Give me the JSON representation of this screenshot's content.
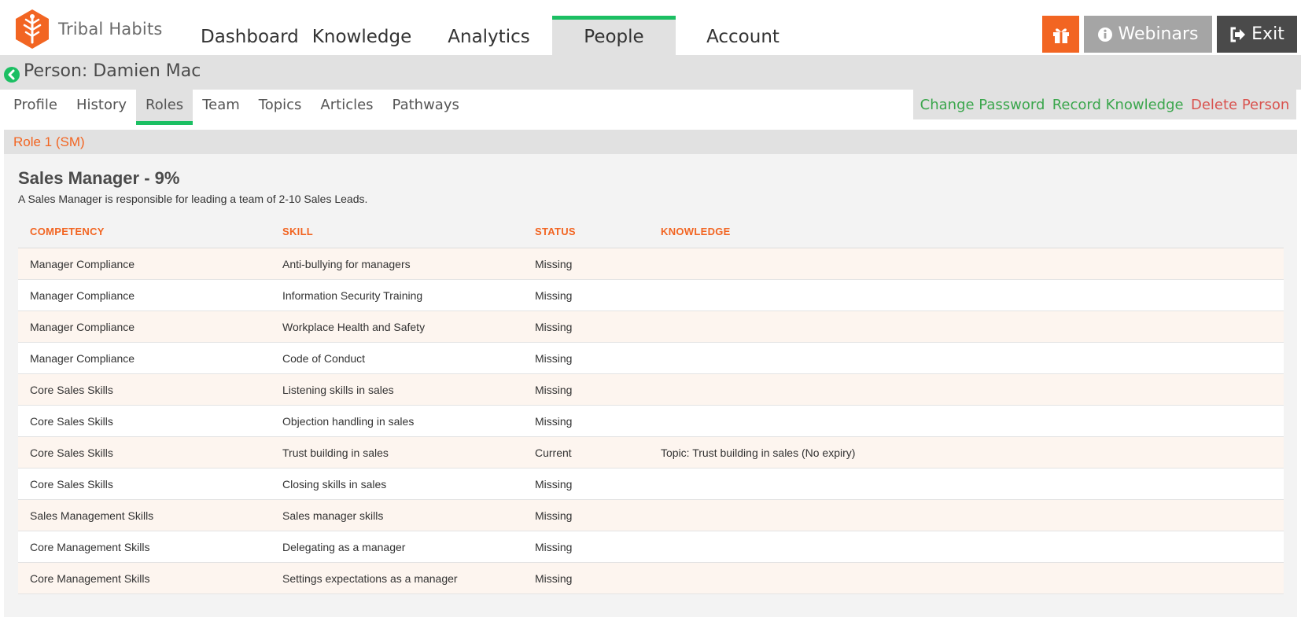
{
  "brand": {
    "name": "Tribal Habits"
  },
  "main_nav": [
    {
      "label": "Dashboard",
      "active": false
    },
    {
      "label": "Knowledge",
      "active": false
    },
    {
      "label": "Analytics",
      "active": false
    },
    {
      "label": "People",
      "active": true
    },
    {
      "label": "Account",
      "active": false
    }
  ],
  "header_buttons": {
    "webinars": "Webinars",
    "exit": "Exit"
  },
  "person": {
    "title": "Person: Damien Mac"
  },
  "sub_nav": [
    {
      "label": "Profile",
      "active": false
    },
    {
      "label": "History",
      "active": false
    },
    {
      "label": "Roles",
      "active": true
    },
    {
      "label": "Team",
      "active": false
    },
    {
      "label": "Topics",
      "active": false
    },
    {
      "label": "Articles",
      "active": false
    },
    {
      "label": "Pathways",
      "active": false
    }
  ],
  "actions": {
    "change_password": "Change Password",
    "record_knowledge": "Record Knowledge",
    "delete_person": "Delete Person"
  },
  "role": {
    "header": "Role 1 (SM)",
    "title": "Sales Manager - 9%",
    "description": "A Sales Manager is responsible for leading a team of 2-10 Sales Leads."
  },
  "table": {
    "headers": {
      "competency": "COMPETENCY",
      "skill": "SKILL",
      "status": "STATUS",
      "knowledge": "KNOWLEDGE"
    },
    "rows": [
      {
        "competency": "Manager Compliance",
        "skill": "Anti-bullying for managers",
        "status": "Missing",
        "knowledge": ""
      },
      {
        "competency": "Manager Compliance",
        "skill": "Information Security Training",
        "status": "Missing",
        "knowledge": ""
      },
      {
        "competency": "Manager Compliance",
        "skill": "Workplace Health and Safety",
        "status": "Missing",
        "knowledge": ""
      },
      {
        "competency": "Manager Compliance",
        "skill": "Code of Conduct",
        "status": "Missing",
        "knowledge": ""
      },
      {
        "competency": "Core Sales Skills",
        "skill": "Listening skills in sales",
        "status": "Missing",
        "knowledge": ""
      },
      {
        "competency": "Core Sales Skills",
        "skill": "Objection handling in sales",
        "status": "Missing",
        "knowledge": ""
      },
      {
        "competency": "Core Sales Skills",
        "skill": "Trust building in sales",
        "status": "Current",
        "knowledge": "Topic: Trust building in sales (No expiry)"
      },
      {
        "competency": "Core Sales Skills",
        "skill": "Closing skills in sales",
        "status": "Missing",
        "knowledge": ""
      },
      {
        "competency": "Sales Management Skills",
        "skill": "Sales manager skills",
        "status": "Missing",
        "knowledge": ""
      },
      {
        "competency": "Core Management Skills",
        "skill": "Delegating as a manager",
        "status": "Missing",
        "knowledge": ""
      },
      {
        "competency": "Core Management Skills",
        "skill": "Settings expectations as a manager",
        "status": "Missing",
        "knowledge": ""
      }
    ]
  },
  "colors": {
    "accent_orange": "#f26522",
    "accent_green": "#1cbf63",
    "link_green": "#3aa64c",
    "link_red": "#d9534f",
    "webinars_grey": "#a5a5a5",
    "exit_dark": "#4a4a4a"
  },
  "icons": {
    "logo": "tribal-tree-logo-icon",
    "gift": "gift-icon",
    "webinars": "info-circle-icon",
    "exit": "sign-out-icon",
    "back": "chevron-left-circle-icon"
  }
}
